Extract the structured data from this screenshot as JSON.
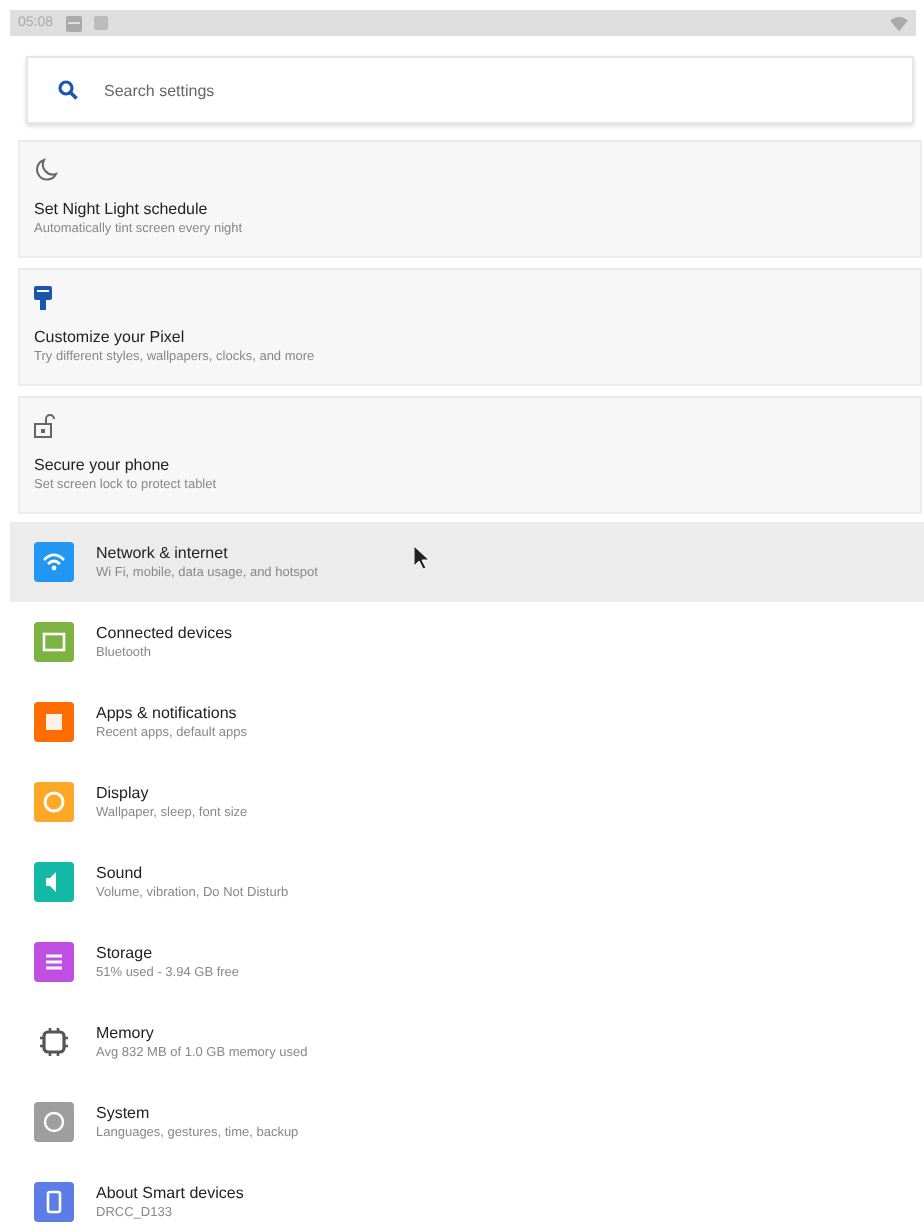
{
  "status_bar": {
    "time": "05:08"
  },
  "search": {
    "placeholder": "Search settings"
  },
  "suggestions": [
    {
      "title": "Set Night Light schedule",
      "summary": "Automatically tint screen every night"
    },
    {
      "title": "Customize your Pixel",
      "summary": "Try different styles, wallpapers, clocks, and more"
    },
    {
      "title": "Secure your phone",
      "summary": "Set screen lock to protect tablet"
    }
  ],
  "settings": [
    {
      "kind": "tile",
      "title": "Network & internet",
      "summary": "Wi Fi, mobile, data usage, and hotspot",
      "color": "#2196f3",
      "selected": true
    },
    {
      "kind": "tile",
      "title": "Connected devices",
      "summary": "Bluetooth",
      "color": "#7cb342",
      "selected": false
    },
    {
      "kind": "tile",
      "title": "Apps & notifications",
      "summary": "Recent apps, default apps",
      "color": "#ff6d00",
      "selected": false
    },
    {
      "kind": "tile",
      "title": "Display",
      "summary": "Wallpaper, sleep, font size",
      "color": "#ffa726",
      "selected": false
    },
    {
      "kind": "tile",
      "title": "Sound",
      "summary": "Volume, vibration, Do Not Disturb",
      "color": "#14b8a6",
      "selected": false
    },
    {
      "kind": "tile",
      "title": "Storage",
      "summary": "51% used - 3.94 GB free",
      "color": "#c04ee0",
      "selected": false
    },
    {
      "kind": "plain",
      "title": "Memory",
      "summary": "Avg 832 MB of 1.0 GB memory used",
      "selected": false
    },
    {
      "kind": "tile",
      "title": "System",
      "summary": "Languages, gestures, time, backup",
      "color": "#9e9e9e",
      "selected": false
    },
    {
      "kind": "tile",
      "title": "About Smart devices",
      "summary": "DRCC_D133",
      "color": "#5c7de8",
      "selected": false
    }
  ]
}
